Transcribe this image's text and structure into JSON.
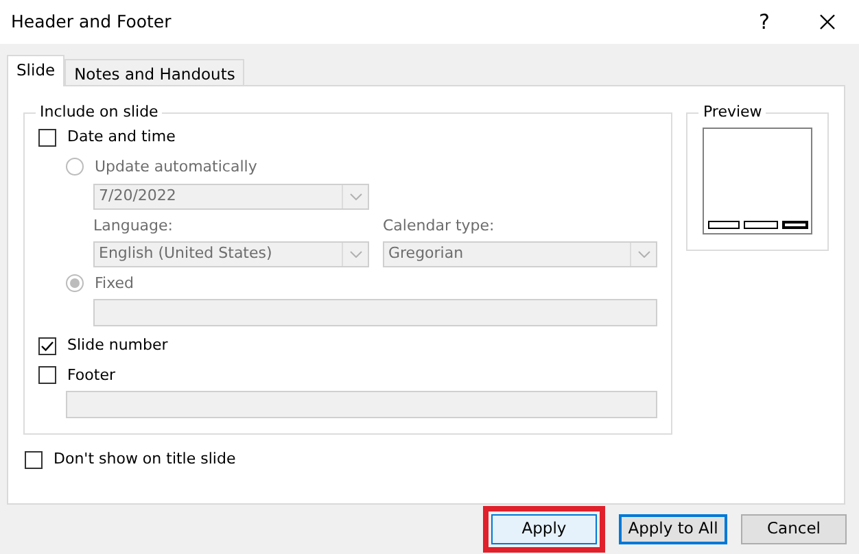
{
  "window": {
    "title": "Header and Footer",
    "help": "?"
  },
  "tabs": [
    {
      "label": "Slide",
      "selected": true
    },
    {
      "label": "Notes and Handouts",
      "selected": false
    }
  ],
  "include_group": {
    "title": "Include on slide",
    "date_and_time": {
      "label": "Date and time",
      "checked": false
    },
    "update_automatically": {
      "label": "Update automatically",
      "selected": false,
      "disabled": true
    },
    "date_dropdown": {
      "value": "7/20/2022",
      "disabled": true
    },
    "language": {
      "label": "Language:",
      "value": "English (United States)",
      "disabled": true
    },
    "calendar_type": {
      "label": "Calendar type:",
      "value": "Gregorian",
      "disabled": true
    },
    "fixed": {
      "label": "Fixed",
      "selected": true,
      "disabled": true
    },
    "fixed_field": {
      "disabled": true
    },
    "slide_number": {
      "label": "Slide number",
      "checked": true
    },
    "footer": {
      "label": "Footer",
      "checked": false
    },
    "footer_field": {
      "disabled": true
    }
  },
  "dont_show_on_title": {
    "label": "Don't show on title slide",
    "checked": false
  },
  "preview": {
    "title": "Preview",
    "placeholders": [
      {
        "highlighted": false
      },
      {
        "highlighted": false
      },
      {
        "highlighted": true
      }
    ]
  },
  "buttons": [
    {
      "label": "Apply",
      "kind": "default",
      "highlighted": true
    },
    {
      "label": "Apply to All",
      "kind": "focused",
      "highlighted": false
    },
    {
      "label": "Cancel",
      "kind": "plain",
      "highlighted": false
    }
  ]
}
